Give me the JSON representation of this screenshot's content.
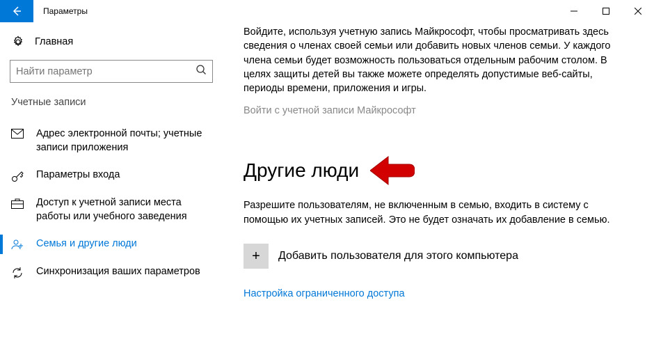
{
  "titlebar": {
    "title": "Параметры"
  },
  "sidebar": {
    "home": "Главная",
    "search_placeholder": "Найти параметр",
    "section": "Учетные записи",
    "items": [
      {
        "label": "Адрес электронной почты; учетные записи приложения"
      },
      {
        "label": "Параметры входа"
      },
      {
        "label": "Доступ к учетной записи места работы или учебного заведения"
      },
      {
        "label": "Семья и другие люди"
      },
      {
        "label": "Синхронизация ваших параметров"
      }
    ]
  },
  "content": {
    "intro": "Войдите, используя учетную запись Майкрософт, чтобы просматривать здесь сведения о членах своей семьи или добавить новых членов семьи. У каждого члена семьи будет возможность пользоваться отдельным рабочим столом. В целях защиты детей вы также можете определять допустимые веб-сайты, периоды времени, приложения и игры.",
    "signin_link": "Войти с учетной записи Майкрософт",
    "heading": "Другие люди",
    "desc": "Разрешите пользователям, не включенным в семью, входить в систему с помощью их учетных записей. Это не будет означать их добавление в семью.",
    "add_user": "Добавить пользователя для этого компьютера",
    "restricted": "Настройка ограниченного доступа"
  }
}
